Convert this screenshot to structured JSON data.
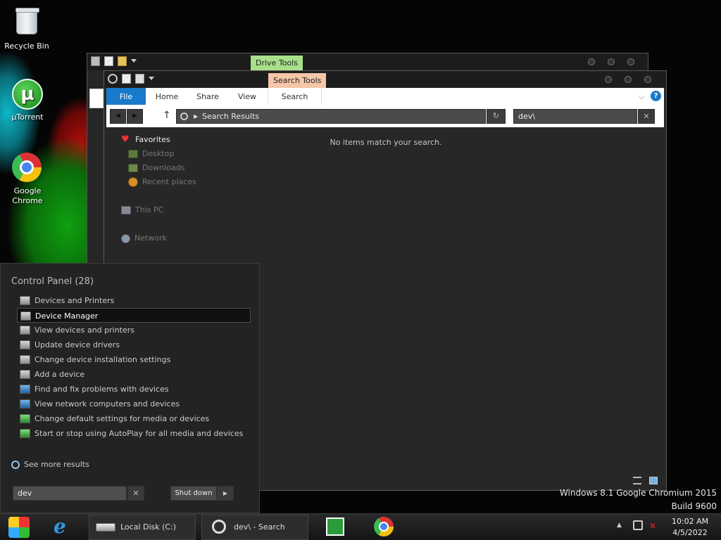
{
  "desktop": {
    "icons": [
      {
        "label": "Recycle Bin",
        "icon": "recycle-bin-icon"
      },
      {
        "label": "µTorrent",
        "icon": "utorrent-icon"
      },
      {
        "label": "Google Chrome",
        "icon": "chrome-icon"
      }
    ],
    "watermark": {
      "line1": "Windows 8.1 Google Chromium 2015",
      "line2": "Build 9600"
    }
  },
  "back_window": {
    "contextual_tab": "Drive Tools",
    "contextual_tab_color": "#a8e08a"
  },
  "explorer": {
    "contextual_tab": "Search Tools",
    "contextual_tab_color": "#f6c6a8",
    "ribbon_tabs": [
      "File",
      "Home",
      "Share",
      "View",
      "Search"
    ],
    "address": "Search Results",
    "search_value": "dev\\",
    "empty_message": "No items match your search.",
    "nav": {
      "favorites": "Favorites",
      "favorites_items": [
        "Desktop",
        "Downloads",
        "Recent places"
      ],
      "this_pc": "This PC",
      "network": "Network"
    },
    "accent": "#1979ca"
  },
  "start_panel": {
    "title": "Control Panel (28)",
    "results": [
      {
        "label": "Devices and Printers",
        "selected": false
      },
      {
        "label": "Device Manager",
        "selected": true
      },
      {
        "label": "View devices and printers",
        "selected": false
      },
      {
        "label": "Update device drivers",
        "selected": false
      },
      {
        "label": "Change device installation settings",
        "selected": false
      },
      {
        "label": "Add a device",
        "selected": false
      },
      {
        "label": "Find and fix problems with devices",
        "selected": false
      },
      {
        "label": "View network computers and devices",
        "selected": false
      },
      {
        "label": "Change default settings for media or devices",
        "selected": false
      },
      {
        "label": "Start or stop using AutoPlay for all media and devices",
        "selected": false
      }
    ],
    "see_more": "See more results",
    "search_value": "dev",
    "shutdown_label": "Shut down"
  },
  "taskbar": {
    "tasks": [
      {
        "label": "Local Disk (C:)",
        "icon": "drive-icon"
      },
      {
        "label": "dev\\ - Search Res...",
        "icon": "search-icon"
      }
    ],
    "pinned": [
      "start-orb-icon",
      "internet-explorer-icon",
      "store-icon",
      "chrome-icon"
    ],
    "clock": {
      "time": "10:02 AM",
      "date": "4/5/2022"
    }
  }
}
